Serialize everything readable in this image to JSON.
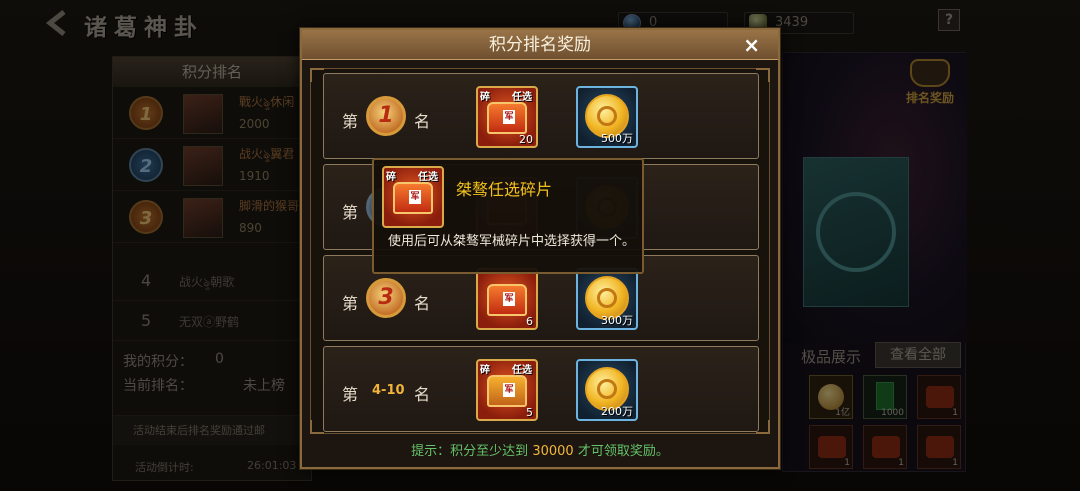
{
  "header": {
    "title": "诸葛神卦",
    "gems": "0",
    "gold": "3439",
    "help": "?"
  },
  "left_panel": {
    "title": "积分排名",
    "top3": [
      {
        "rank": "1",
        "name": "戰火ৡ休闲",
        "score": "2000"
      },
      {
        "rank": "2",
        "name": "战火ৡ翼君",
        "score": "1910"
      },
      {
        "rank": "3",
        "name": "脚滑的猴哥",
        "score": "890"
      }
    ],
    "others": [
      {
        "rank": "4",
        "name": "战火ৡ朝歌"
      },
      {
        "rank": "5",
        "name": "无双ⓐ野鹤"
      }
    ],
    "my_score_label": "我的积分：",
    "my_score": "0",
    "my_rank_label": "当前排名：",
    "my_rank": "未上榜",
    "note": "活动结束后排名奖励通过邮",
    "countdown_label": "活动倒计时:",
    "countdown": "26:01:03"
  },
  "right_panel": {
    "badge": "排名奖励",
    "showcase_label": "极品展示",
    "view_all": "查看全部",
    "slots": [
      {
        "icon": "coin-icon",
        "count": "1亿"
      },
      {
        "icon": "jade-icon",
        "count": "1000"
      },
      {
        "icon": "chest-icon",
        "count": "1"
      },
      {
        "icon": "chest-icon",
        "count": "1"
      },
      {
        "icon": "chest-icon",
        "count": "1"
      },
      {
        "icon": "chest-icon",
        "count": "1"
      }
    ]
  },
  "modal": {
    "title": "积分排名奖励",
    "close": "×",
    "di": "第",
    "ming": "名",
    "rows": [
      {
        "rank": "1",
        "chest_count": "20",
        "coin_amount": "500万"
      },
      {
        "rank": "2",
        "chest_count": "",
        "coin_amount": ""
      },
      {
        "rank": "3",
        "chest_count": "6",
        "coin_amount": "300万"
      },
      {
        "rank": "4-10",
        "chest_count": "5",
        "coin_amount": "200万"
      }
    ],
    "chest_label_left": "碎",
    "chest_label_right": "任选",
    "chest_tag": "军",
    "hint_prefix": "提示：积分至少达到",
    "hint_value": "30000",
    "hint_suffix": "才可领取奖励。"
  },
  "tooltip": {
    "title": "桀骜任选碎片",
    "description": "使用后可从桀骜军械碎片中选择获得一个。",
    "label_left": "碎",
    "label_right": "任选",
    "tag": "军"
  }
}
